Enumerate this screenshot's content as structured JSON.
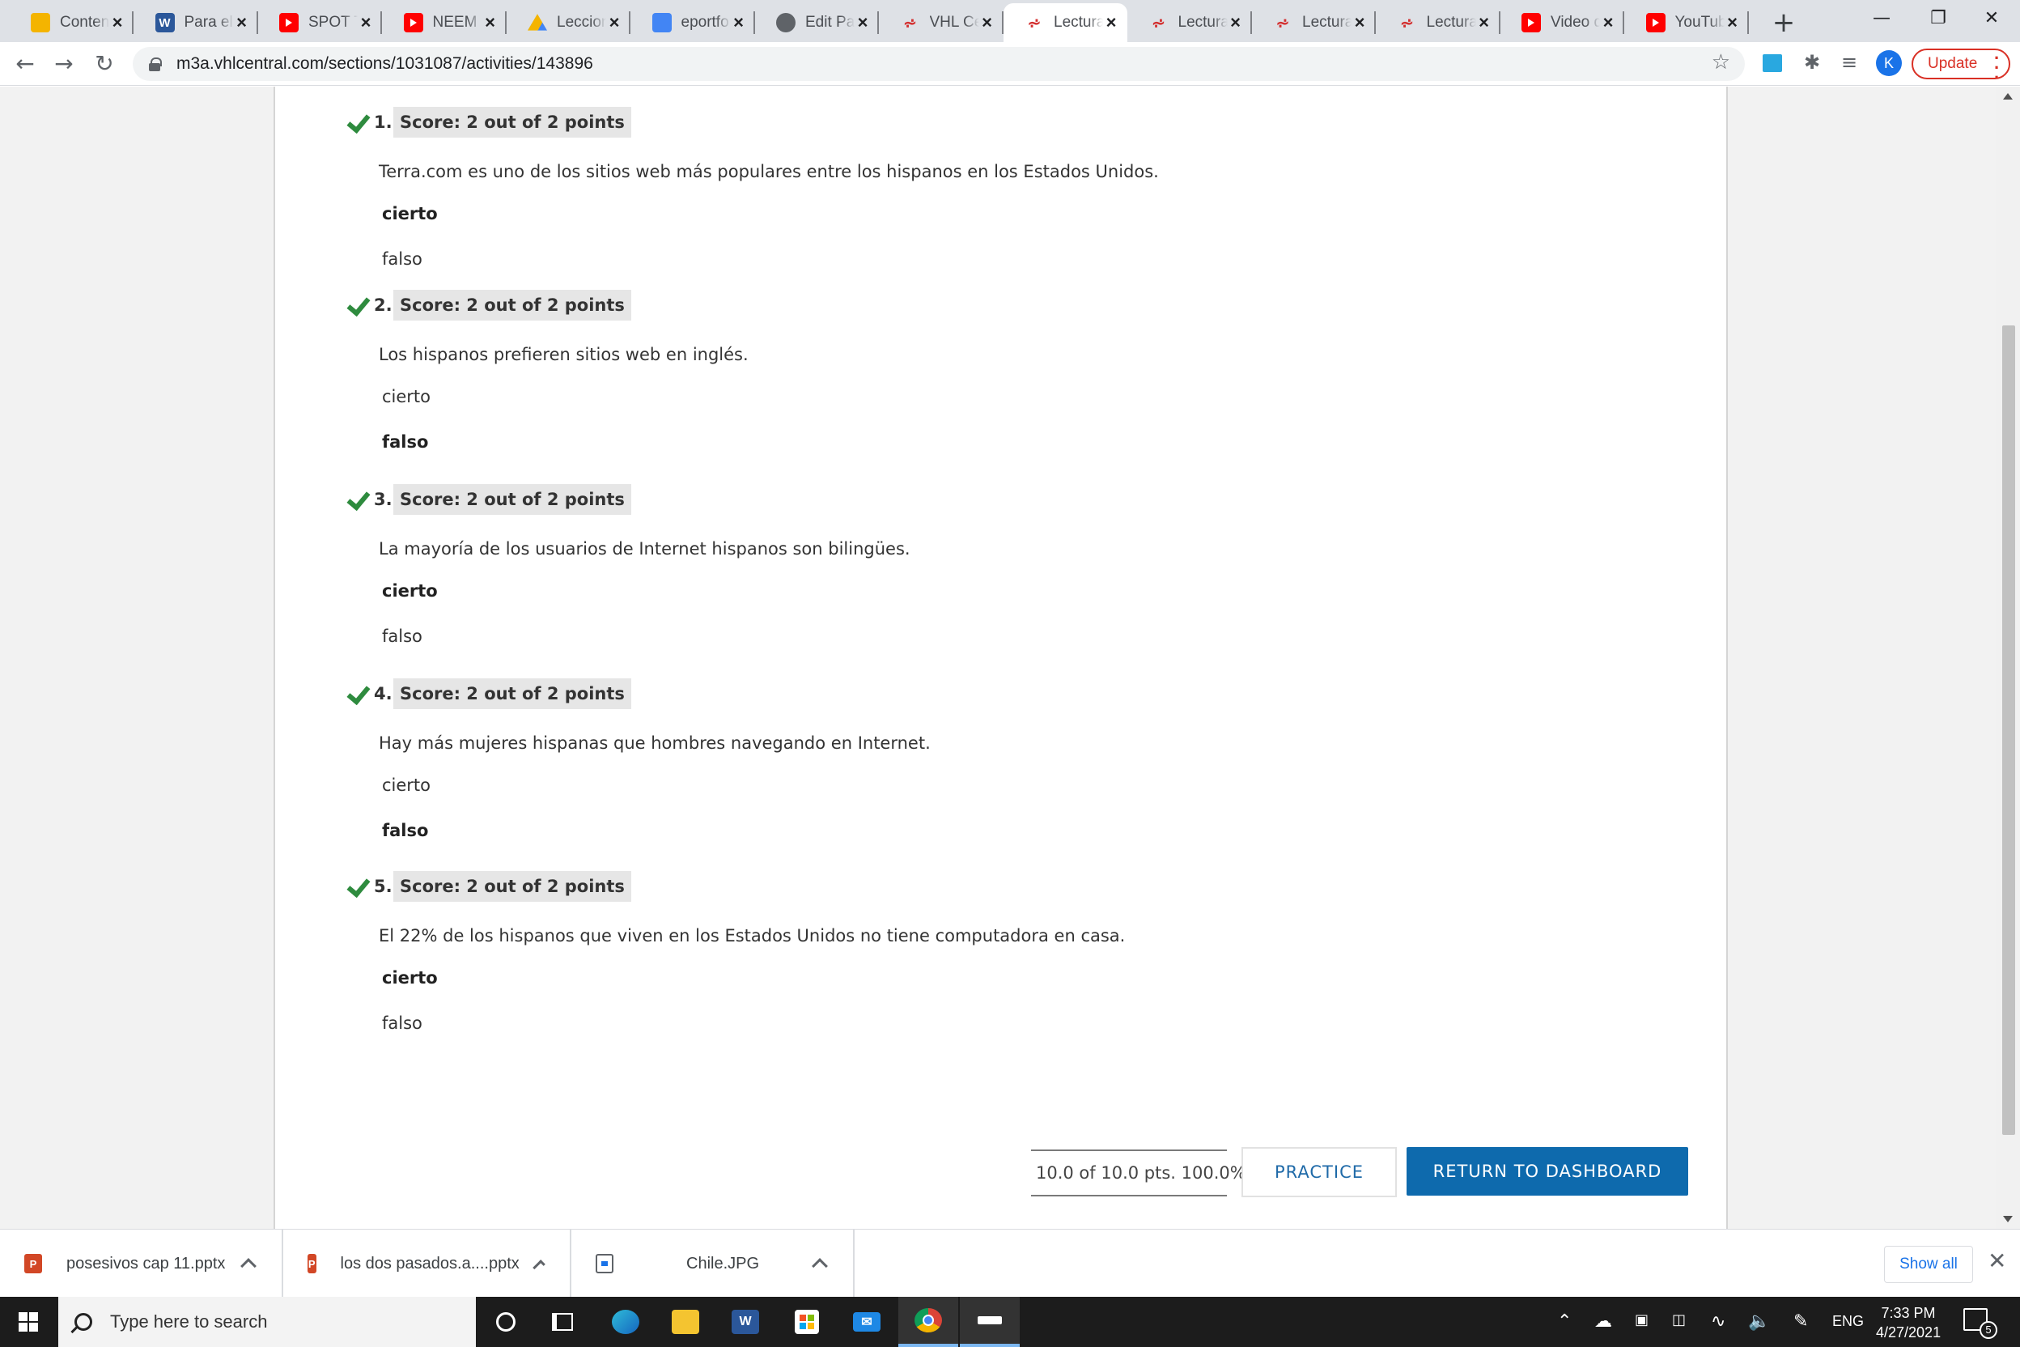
{
  "browser": {
    "tabs": [
      {
        "label": "Conten",
        "icon": "pencil-icon",
        "active": false
      },
      {
        "label": "Para el",
        "icon": "word-icon",
        "active": false
      },
      {
        "label": "SPOT Ti",
        "icon": "youtube-icon",
        "active": false
      },
      {
        "label": "NEEM ·",
        "icon": "youtube-icon",
        "active": false
      },
      {
        "label": "Leccion",
        "icon": "google-drive-icon",
        "active": false
      },
      {
        "label": "eportfo",
        "icon": "google-docs-icon",
        "active": false
      },
      {
        "label": "Edit Pa",
        "icon": "globe-icon",
        "active": false
      },
      {
        "label": "VHL Ce",
        "icon": "vhl-icon",
        "active": false
      },
      {
        "label": "Lectura",
        "icon": "vhl-icon",
        "active": true
      },
      {
        "label": "Lectura",
        "icon": "vhl-icon",
        "active": false
      },
      {
        "label": "Lectura",
        "icon": "vhl-icon",
        "active": false
      },
      {
        "label": "Lectura",
        "icon": "vhl-icon",
        "active": false
      },
      {
        "label": "Video d",
        "icon": "youtube-icon",
        "active": false
      },
      {
        "label": "YouTub",
        "icon": "youtube-icon",
        "active": false
      }
    ],
    "new_tab_label": "+",
    "url": "m3a.vhlcentral.com/sections/1031087/activities/143896",
    "profile_initial": "K",
    "update_label": "Update"
  },
  "quiz": {
    "questions": [
      {
        "number": "1.",
        "score": "Score: 2 out of 2 points",
        "text": "Terra.com es uno de los sitios web más populares entre los hispanos en los Estados Unidos.",
        "options": [
          "cierto",
          "falso"
        ],
        "selected": "cierto"
      },
      {
        "number": "2.",
        "score": "Score: 2 out of 2 points",
        "text": "Los hispanos prefieren sitios web en inglés.",
        "options": [
          "cierto",
          "falso"
        ],
        "selected": "falso"
      },
      {
        "number": "3.",
        "score": "Score: 2 out of 2 points",
        "text": "La mayoría de los usuarios de Internet hispanos son bilingües.",
        "options": [
          "cierto",
          "falso"
        ],
        "selected": "cierto"
      },
      {
        "number": "4.",
        "score": "Score: 2 out of 2 points",
        "text": "Hay más mujeres hispanas que hombres navegando en Internet.",
        "options": [
          "cierto",
          "falso"
        ],
        "selected": "falso"
      },
      {
        "number": "5.",
        "score": "Score: 2 out of 2 points",
        "text": "El 22% de los hispanos que viven en los Estados Unidos no tiene computadora en casa.",
        "options": [
          "cierto",
          "falso"
        ],
        "selected": "cierto"
      }
    ],
    "total": "10.0 of 10.0 pts. 100.0%",
    "practice_label": "PRACTICE",
    "return_label": "RETURN TO DASHBOARD"
  },
  "downloads": {
    "items": [
      {
        "name": "posesivos cap 11.pptx",
        "type": "pptx"
      },
      {
        "name": "los dos pasados.a....pptx",
        "type": "pptx"
      },
      {
        "name": "Chile.JPG",
        "type": "jpg"
      }
    ],
    "show_all_label": "Show all"
  },
  "taskbar": {
    "search_placeholder": "Type here to search",
    "language": "ENG",
    "time": "7:33 PM",
    "date": "4/27/2021",
    "notification_count": "5"
  },
  "colors": {
    "accent_blue": "#0e6aad",
    "check_green": "#2e8b3e",
    "update_red": "#d93025"
  }
}
